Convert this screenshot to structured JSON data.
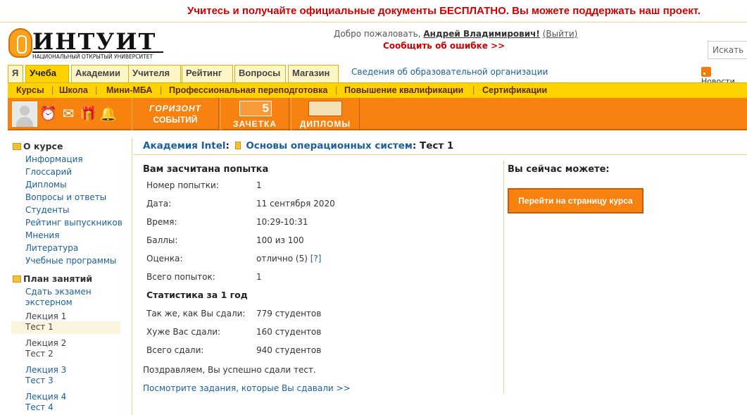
{
  "banner": {
    "text": "Учитесь и получайте официальные документы БЕСПЛАТНО. Вы можете поддержать наш проект."
  },
  "logo": {
    "name": "ИНТУИТ",
    "subtitle": "НАЦИОНАЛЬНЫЙ ОТКРЫТЫЙ УНИВЕРСИТЕТ"
  },
  "header": {
    "welcome_prefix": "Добро пожаловать,",
    "user_name": "Андрей Владимирович!",
    "logout_label": "(Выйти)",
    "report_error": "Сообщить об ошибке >>",
    "search_placeholder": "Искать",
    "edu_info_link": "Сведения об образовательной организации",
    "news_label": "Новости"
  },
  "tabs": [
    {
      "label": "Я"
    },
    {
      "label": "Учеба",
      "active": true
    },
    {
      "label": "Академии"
    },
    {
      "label": "Учителя"
    },
    {
      "label": "Рейтинг"
    },
    {
      "label": "Вопросы"
    },
    {
      "label": "Магазин"
    }
  ],
  "subnav": [
    "Курсы",
    "Школа",
    "Мини-МБА",
    "Профессиональная переподготовка",
    "Повышение квалификации",
    "Сертификации"
  ],
  "toolbar": {
    "icons": [
      "alarm-clock-icon",
      "envelope-icon",
      "gift-icon",
      "bell-icon"
    ],
    "promo": [
      {
        "label": "ГОРИЗОНТ",
        "label2": "СОБЫТИЙ"
      },
      {
        "label": "ЗАЧЕТКА",
        "badge": "5"
      },
      {
        "label": "ДИПЛОМЫ"
      }
    ]
  },
  "sidebar": {
    "about_title": "О курсе",
    "about_items": [
      "Информация",
      "Глоссарий",
      "Дипломы",
      "Вопросы и ответы",
      "Студенты",
      "Рейтинг выпускников",
      "Мнения",
      "Литература",
      "Учебные программы"
    ],
    "plan_title": "План занятий",
    "plan_items": [
      {
        "line1": "Сдать экзамен",
        "line2": "экстерном",
        "link": true
      },
      {
        "line1": "Лекция 1",
        "line2": "Тест 1",
        "selected": true
      },
      {
        "line1": "Лекция 2",
        "line2": "Тест 2"
      },
      {
        "line1": "Лекция 3",
        "line2": "Тест 3"
      },
      {
        "line1": "Лекция 4",
        "line2": "Тест 4"
      }
    ]
  },
  "breadcrumb": {
    "academy": "Академия Intel",
    "course": "Основы операционных систем",
    "current": "Тест 1"
  },
  "result": {
    "title": "Вам засчитана попытка",
    "rows": [
      {
        "label": "Номер попытки:",
        "value": "1"
      },
      {
        "label": "Дата:",
        "value": "11 сентября 2020"
      },
      {
        "label": "Время:",
        "value": "10:29-10:31"
      },
      {
        "label": "Баллы:",
        "value": "100 из 100"
      },
      {
        "label": "Оценка:",
        "value": "отлично (5)",
        "help": "[?]"
      },
      {
        "label": "Всего попыток:",
        "value": "1"
      }
    ],
    "stats_title": "Статистика за 1 год",
    "stats": [
      {
        "label": "Так же, как Вы сдали:",
        "value": "779 студентов"
      },
      {
        "label": "Хуже Вас сдали:",
        "value": "160 студентов"
      },
      {
        "label": "Всего сдали:",
        "value": "940 студентов"
      }
    ],
    "congrats": "Поздравляем, Вы успешно сдали тест.",
    "tasks_link": "Посмотрите задания, которые Вы сдавали >>"
  },
  "actions": {
    "title": "Вы сейчас можете:",
    "go_course_button": "Перейти на страницу курса"
  },
  "colors": {
    "accent": "#f7820f",
    "tab_yellow": "#ffd200",
    "alert_red": "#d40000",
    "link": "#1a5f9e"
  }
}
